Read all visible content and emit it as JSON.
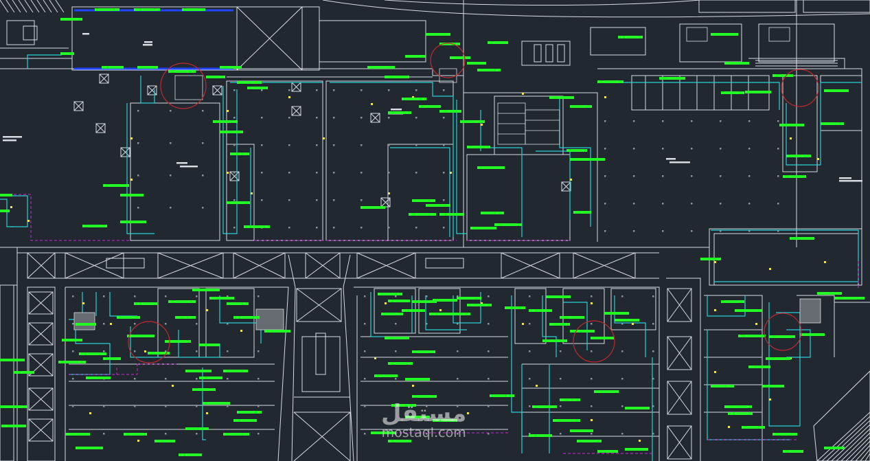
{
  "colors": {
    "background": "#212830",
    "walls": "#d8dde3",
    "duct": "#2ad0d8",
    "tag": "#22ff22",
    "zone": "#d02ad6",
    "marker": "#c0282e",
    "fixture": "#f0e64a",
    "grid": "#8a929b",
    "glazing": "#2244ff"
  },
  "watermark": {
    "arabic": "مستقل",
    "latin": "mostaql.com"
  }
}
